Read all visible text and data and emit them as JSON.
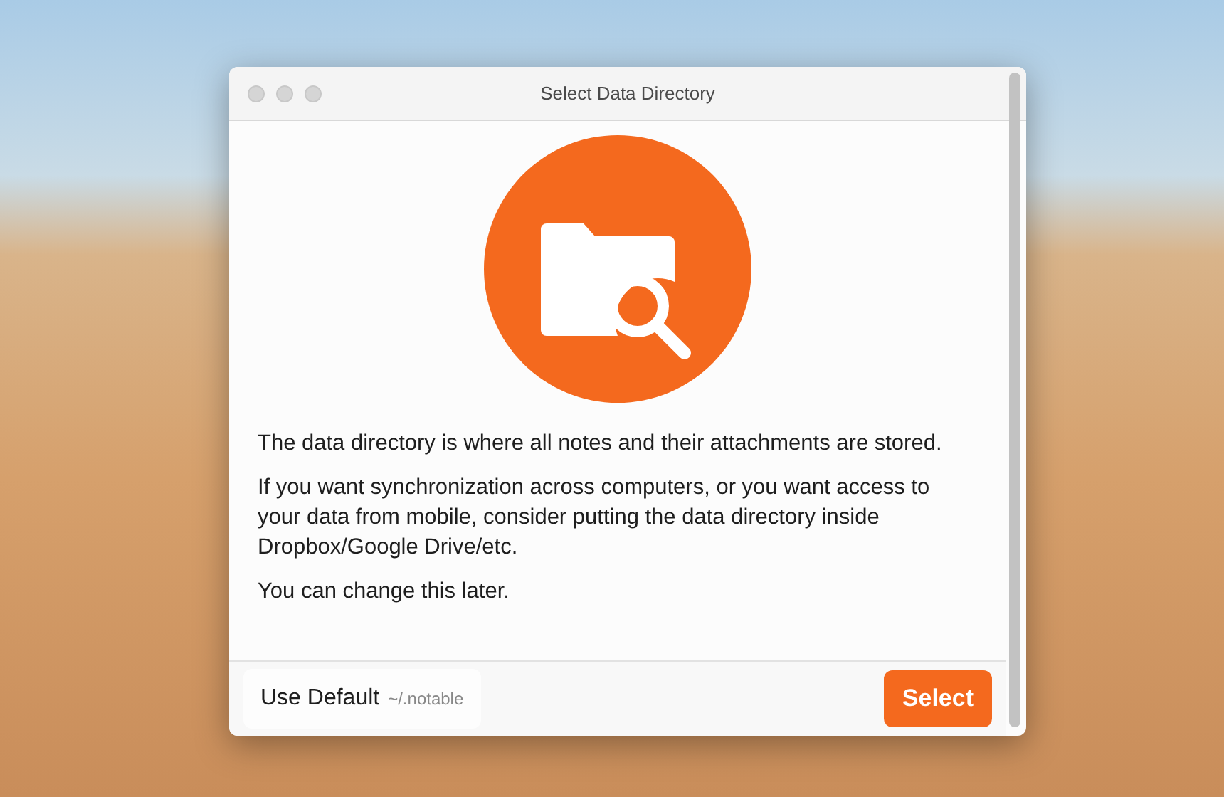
{
  "window": {
    "title": "Select Data Directory"
  },
  "paragraphs": [
    "The data directory is where all notes and their attachments are stored.",
    "If you want synchronization across computers, or you want access to your data from mobile, consider putting the data directory inside Dropbox/Google Drive/etc.",
    "You can change this later."
  ],
  "buttons": [
    {
      "kind": "secondary",
      "label": "Use Default",
      "hint": "~/.notable"
    },
    {
      "kind": "primary",
      "label": "Select"
    }
  ]
}
